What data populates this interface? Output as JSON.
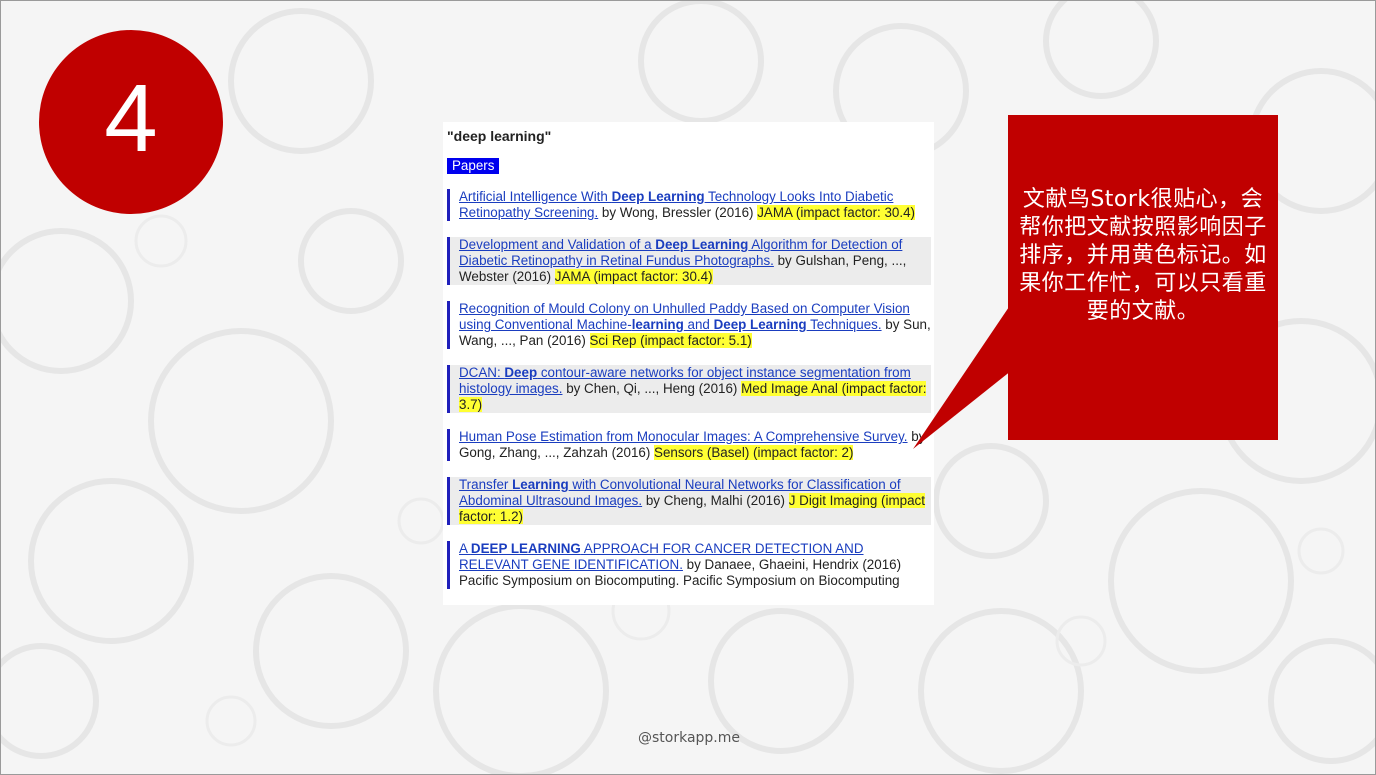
{
  "slide": {
    "step_number": "4",
    "footer": "@storkapp.me"
  },
  "results": {
    "query": "\"deep learning\"",
    "section_tag": "Papers",
    "entries": [
      {
        "title_pre": "Artificial Intelligence With ",
        "title_bold": "Deep Learning",
        "title_post": " Technology Looks Into Diabetic Retinopathy Screening.",
        "authors": " by Wong, Bressler (2016) ",
        "journal": "JAMA (impact factor: 30.4)"
      },
      {
        "title_pre": "Development and Validation of a ",
        "title_bold": "Deep Learning",
        "title_post": " Algorithm for Detection of Diabetic Retinopathy in Retinal Fundus Photographs.",
        "authors": " by Gulshan, Peng, ..., Webster (2016) ",
        "journal": "JAMA (impact factor: 30.4)"
      },
      {
        "title_pre": "Recognition of Mould Colony on Unhulled Paddy Based on Computer Vision using Conventional Machine-",
        "title_bold": "learning",
        "title_mid": " and ",
        "title_bold2": "Deep Learning",
        "title_post": " Techniques.",
        "authors": " by Sun, Wang, ..., Pan (2016) ",
        "journal": "Sci Rep (impact factor: 5.1)"
      },
      {
        "title_pre": "DCAN: ",
        "title_bold": "Deep",
        "title_post": " contour-aware networks for object instance segmentation from histology images.",
        "authors": " by Chen, Qi, ..., Heng (2016) ",
        "journal": "Med Image Anal (impact factor: 3.7)"
      },
      {
        "title_pre": "Human Pose Estimation from Monocular Images: A Comprehensive Survey.",
        "authors": " by Gong, Zhang, ..., Zahzah (2016) ",
        "journal": "Sensors (Basel) (impact factor: 2)"
      },
      {
        "title_pre": "Transfer ",
        "title_bold": "Learning",
        "title_post": " with Convolutional Neural Networks for Classification of Abdominal Ultrasound Images.",
        "authors": " by Cheng, Malhi (2016) ",
        "journal": "J Digit Imaging (impact factor: 1.2)"
      },
      {
        "title_pre": "A ",
        "title_bold": "DEEP LEARNING",
        "title_post": " APPROACH FOR CANCER DETECTION AND RELEVANT GENE IDENTIFICATION.",
        "authors": " by Danaee, Ghaeini, Hendrix (2016) Pacific Symposium on Biocomputing. Pacific Symposium on Biocomputing"
      }
    ]
  },
  "callout": {
    "text": "文献鸟Stork很贴心，会帮你把文献按照影响因子排序，并用黄色标记。如果你工作忙，可以只看重要的文献。"
  },
  "colors": {
    "accent_red": "#c00000",
    "highlight_yellow": "#ffff33",
    "link_blue": "#1a3dbf",
    "tag_blue": "#0000ee"
  }
}
